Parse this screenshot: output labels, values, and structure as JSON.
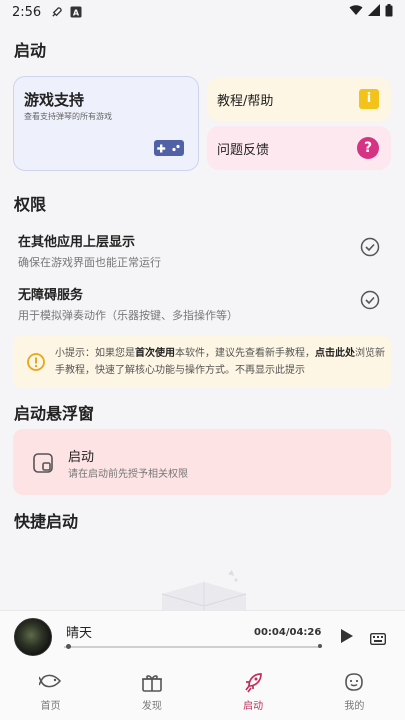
{
  "status_bar": {
    "time": "2:56",
    "left_icons": [
      "rocket-icon",
      "text-a-icon"
    ],
    "right_icons": [
      "wifi-icon",
      "signal-icon",
      "battery-icon"
    ]
  },
  "page_title": "启动",
  "cards": {
    "game_support": {
      "title": "游戏支持",
      "subtitle": "查看支持弹琴的所有游戏",
      "icon": "gamepad-icon"
    },
    "help": {
      "label": "教程/帮助",
      "icon": "info-icon",
      "icon_glyph": "i"
    },
    "feedback": {
      "label": "问题反馈",
      "icon": "question-icon",
      "icon_glyph": "?"
    }
  },
  "permissions": {
    "heading": "权限",
    "items": [
      {
        "title": "在其他应用上层显示",
        "desc": "确保在游戏界面也能正常运行"
      },
      {
        "title": "无障碍服务",
        "desc": "用于模拟弹奏动作（乐器按键、多指操作等）"
      }
    ]
  },
  "tip": {
    "p1": "小提示：如果您是",
    "b1": "首次使用",
    "p2": "本软件，建议先查看新手教程，",
    "b2": "点击此处",
    "p3": "浏览新手教程，快速了解核心功能与操作方式。不再显示此提示"
  },
  "floating_window": {
    "heading": "启动悬浮窗",
    "title": "启动",
    "desc": "请在启动前先授予相关权限"
  },
  "quick_launch": {
    "heading": "快捷启动"
  },
  "player": {
    "song": "晴天",
    "time": "00:04/04:26",
    "progress": 0.016
  },
  "tabs": [
    {
      "label": "首页",
      "icon": "fish-icon"
    },
    {
      "label": "发现",
      "icon": "gift-icon"
    },
    {
      "label": "启动",
      "icon": "rocket-icon"
    },
    {
      "label": "我的",
      "icon": "smile-face-icon"
    }
  ],
  "colors": {
    "accent": "#c0305a",
    "game_card_bg": "#eef0fb",
    "help_bg": "#fdf6e4",
    "feedback_bg": "#fde8ef",
    "float_bg": "#fde3e3"
  }
}
